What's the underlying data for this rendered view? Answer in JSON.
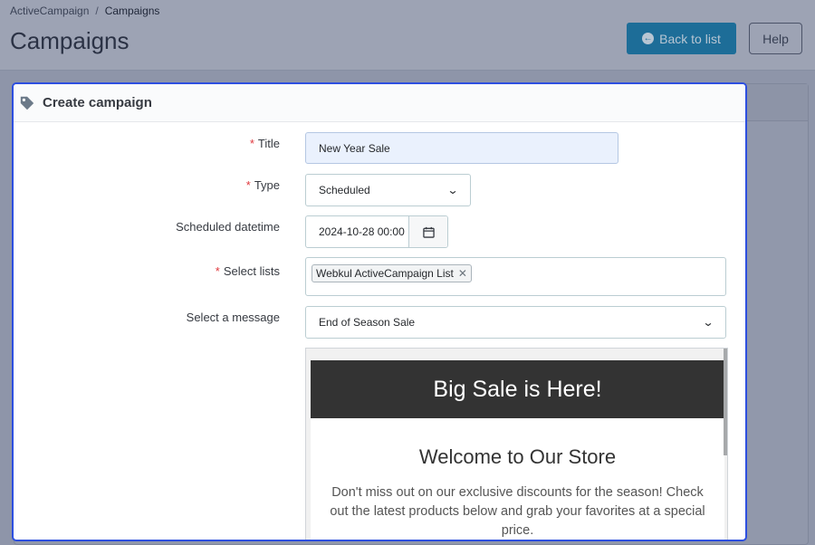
{
  "breadcrumb": {
    "root": "ActiveCampaign",
    "separator": "/",
    "current": "Campaigns"
  },
  "page": {
    "title": "Campaigns"
  },
  "toolbar": {
    "back_label": "Back to list",
    "help_label": "Help"
  },
  "modal": {
    "title": "Create campaign",
    "required_marker": "*",
    "fields": {
      "title": {
        "label": "Title",
        "value": "New Year Sale"
      },
      "type": {
        "label": "Type",
        "value": "Scheduled"
      },
      "scheduled": {
        "label": "Scheduled datetime",
        "value": "2024-10-28 00:00"
      },
      "lists": {
        "label": "Select lists",
        "chips": [
          "Webkul ActiveCampaign List"
        ],
        "remove_glyph": "✕"
      },
      "message": {
        "label": "Select a message",
        "value": "End of Season Sale"
      }
    },
    "preview": {
      "banner": "Big Sale is Here!",
      "heading": "Welcome to Our Store",
      "body": "Don't miss out on our exclusive discounts for the season! Check out the latest products below and grab your favorites at a special price."
    }
  },
  "icons": {
    "tag": "tag-icon",
    "calendar": "calendar-icon",
    "back": "arrow-left-circle-icon",
    "chevron": "chevron-down-icon"
  },
  "colors": {
    "accent": "#2d4fe0",
    "primary_button": "#1d6d98",
    "required": "#e0393e",
    "banner": "#333333"
  }
}
